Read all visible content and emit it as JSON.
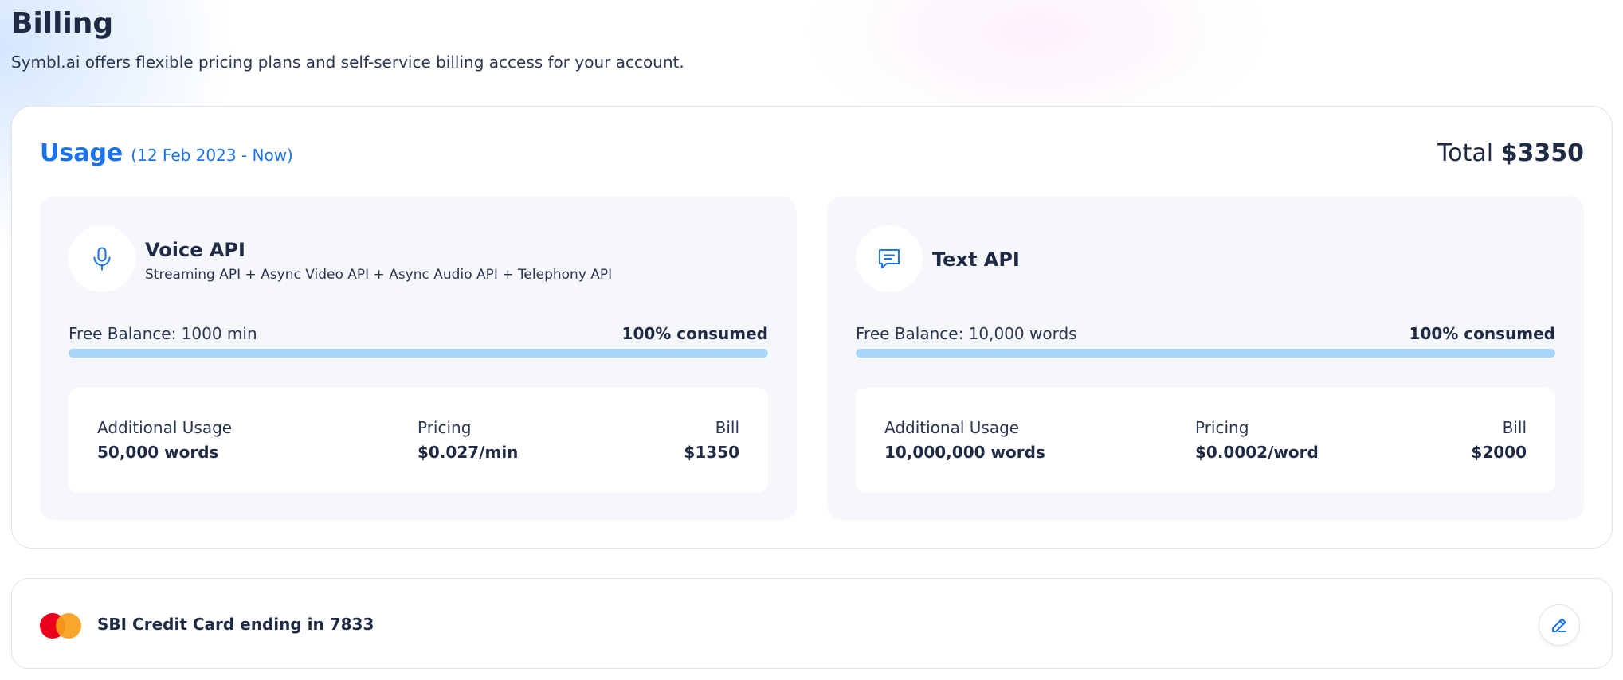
{
  "page": {
    "title": "Billing",
    "subtitle": "Symbl.ai offers flexible pricing plans and self-service billing access for your account."
  },
  "usage": {
    "title": "Usage",
    "range": "(12 Feb 2023 - Now)",
    "total_label": "Total",
    "total_value": "$3350"
  },
  "voice_api": {
    "icon": "microphone-icon",
    "name": "Voice API",
    "description": "Streaming API + Async Video API + Async Audio API + Telephony API",
    "balance_label": "Free Balance: 1000 min",
    "consumed_text": "100% consumed",
    "consumed_fraction": 1.0,
    "additional_usage_label": "Additional Usage",
    "additional_usage_value": "50,000 words",
    "pricing_label": "Pricing",
    "pricing_value": "$0.027/min",
    "bill_label": "Bill",
    "bill_value": "$1350"
  },
  "text_api": {
    "icon": "chat-message-icon",
    "name": "Text API",
    "balance_label": "Free Balance: 10,000 words",
    "consumed_text": "100% consumed",
    "consumed_fraction": 1.0,
    "additional_usage_label": "Additional Usage",
    "additional_usage_value": "10,000,000 words",
    "pricing_label": "Pricing",
    "pricing_value": "$0.0002/word",
    "bill_label": "Bill",
    "bill_value": "$2000"
  },
  "payment": {
    "card_brand_icon": "mastercard-icon",
    "card_label": "SBI Credit Card ending in 7833",
    "edit_icon": "edit-pencil-icon"
  },
  "colors": {
    "accent": "#1a73e8",
    "text_dark": "#1f2a44",
    "progress_fill": "#a8d6fb",
    "panel_bg": "#f5f7fb",
    "mastercard_red": "#eb001b",
    "mastercard_orange": "#f79e1b"
  }
}
